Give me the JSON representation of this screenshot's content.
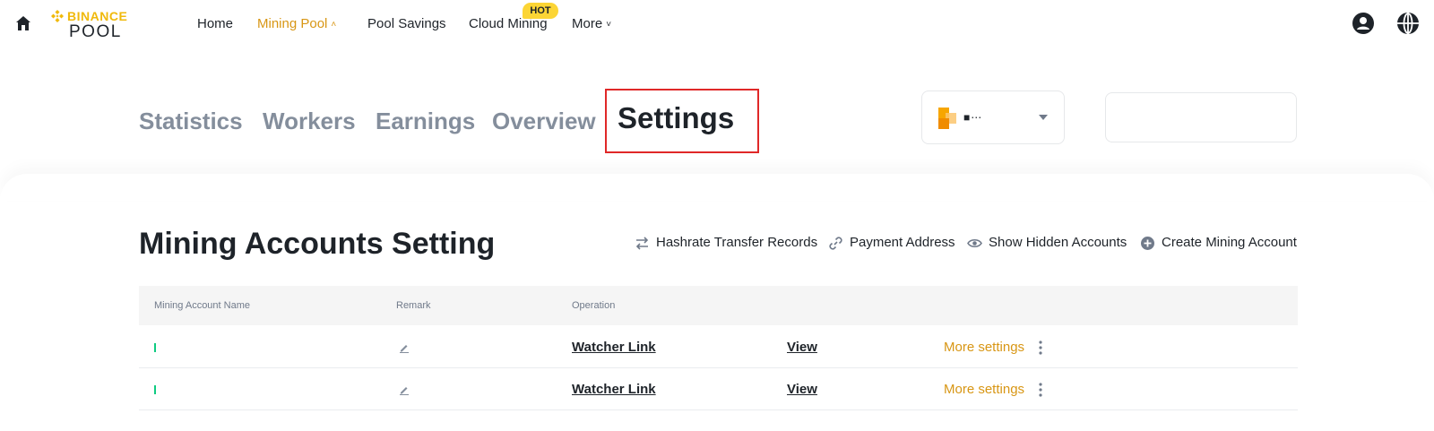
{
  "brand": {
    "top": "BINANCE",
    "bottom": "POOL"
  },
  "nav": {
    "items": [
      {
        "label": "Home"
      },
      {
        "label": "Mining Pool",
        "active": true
      },
      {
        "label": "Pool Savings"
      },
      {
        "label": "Cloud Mining"
      },
      {
        "label": "More"
      }
    ],
    "hot_badge": "HOT"
  },
  "icons": {
    "home": "home-icon",
    "account": "account-icon",
    "globe": "globe-icon"
  },
  "tabs": [
    {
      "label": "Statistics"
    },
    {
      "label": "Workers"
    },
    {
      "label": "Earnings"
    },
    {
      "label": "Overview"
    },
    {
      "label": "Settings",
      "selected": true
    }
  ],
  "coin_select": {
    "value": "■⋯"
  },
  "search": {
    "value": ""
  },
  "section": {
    "title": "Mining Accounts Setting",
    "actions": [
      {
        "label": "Hashrate Transfer Records",
        "icon": "transfer-icon"
      },
      {
        "label": "Payment Address",
        "icon": "link-icon"
      },
      {
        "label": "Show Hidden Accounts",
        "icon": "eye-icon"
      },
      {
        "label": "Create Mining Account",
        "icon": "plus-circle-icon"
      }
    ]
  },
  "table": {
    "headers": [
      "Mining Account Name",
      "Remark",
      "Operation"
    ],
    "rows": [
      {
        "watcher": "Watcher Link",
        "view": "View",
        "more": "More settings"
      },
      {
        "watcher": "Watcher Link",
        "view": "View",
        "more": "More settings"
      }
    ]
  },
  "colors": {
    "accent": "#d89614",
    "brand_yellow": "#f0b90b",
    "highlight": "#e02828",
    "status": "#0ecb81"
  }
}
